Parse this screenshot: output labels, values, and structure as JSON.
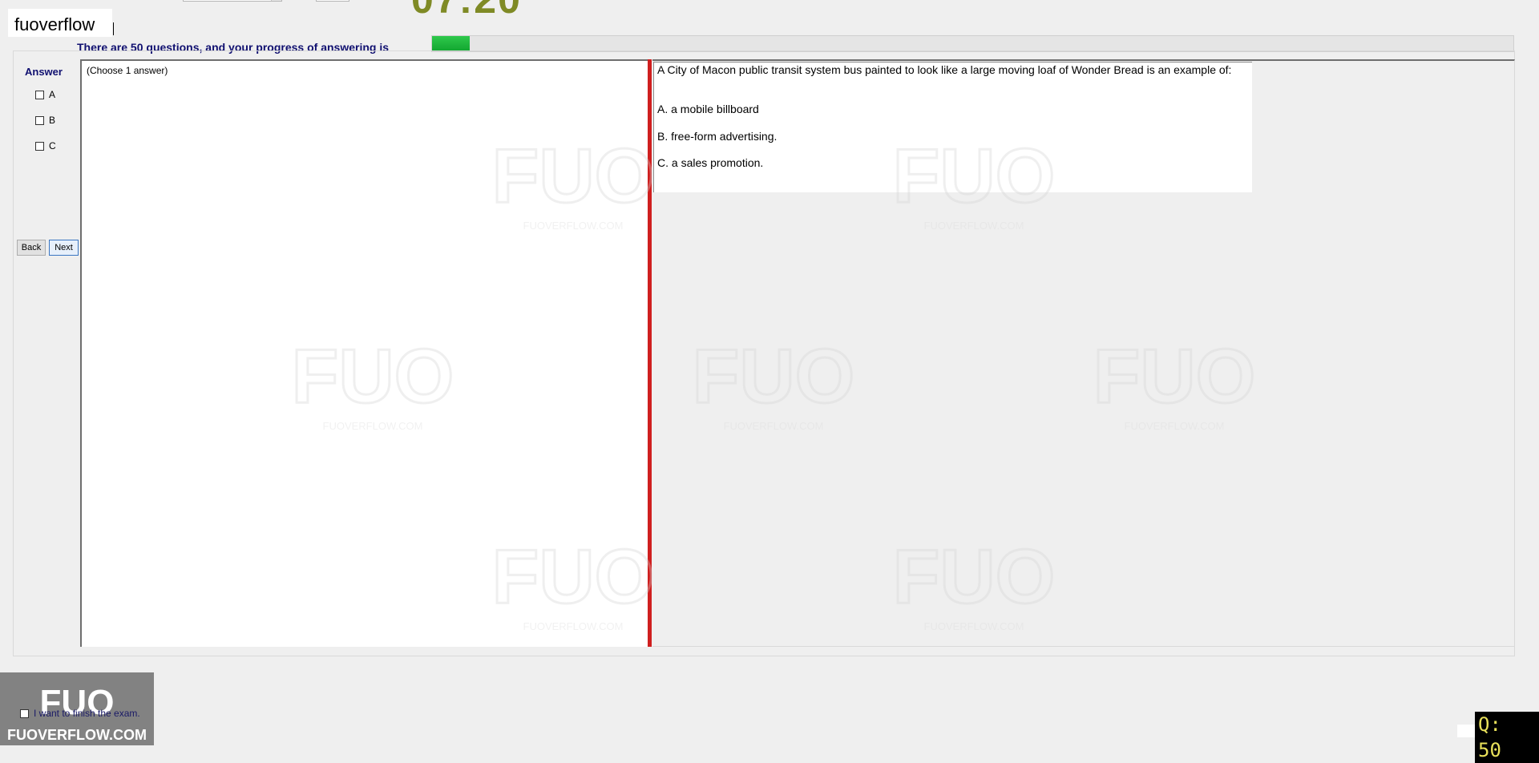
{
  "header": {
    "brand": "fuoverflow",
    "timer": "07:20",
    "progress_label": "There are 50 questions, and your progress of answering is",
    "progress_fraction": 0.035
  },
  "sidebar": {
    "answer_title": "Answer",
    "options": [
      {
        "label": "A",
        "checked": false
      },
      {
        "label": "B",
        "checked": false
      },
      {
        "label": "C",
        "checked": false
      }
    ],
    "back_label": "Back",
    "next_label": "Next"
  },
  "left_panel": {
    "instruction": "(Choose 1 answer)"
  },
  "question": {
    "text": "A City of Macon public transit system bus painted to look like a large moving loaf of Wonder Bread is an example of:",
    "choices": [
      "A.  a mobile billboard",
      "B.  free-form advertising.",
      "C.  a sales promotion."
    ]
  },
  "footer": {
    "finish_label": "I want to finish the exam.",
    "logo_text": "FUO",
    "logo_subtext": "FUOVERFLOW.COM",
    "question_counter": "Q: 50"
  },
  "watermark": {
    "logo_text": "FUO",
    "subtext": "FUOVERFLOW.COM"
  },
  "colors": {
    "accent_navy": "#101070",
    "timer": "#7f8a25",
    "progress_green": "#11a52f",
    "divider_red": "#cf1f1f",
    "counter_text": "#e8e05a"
  }
}
